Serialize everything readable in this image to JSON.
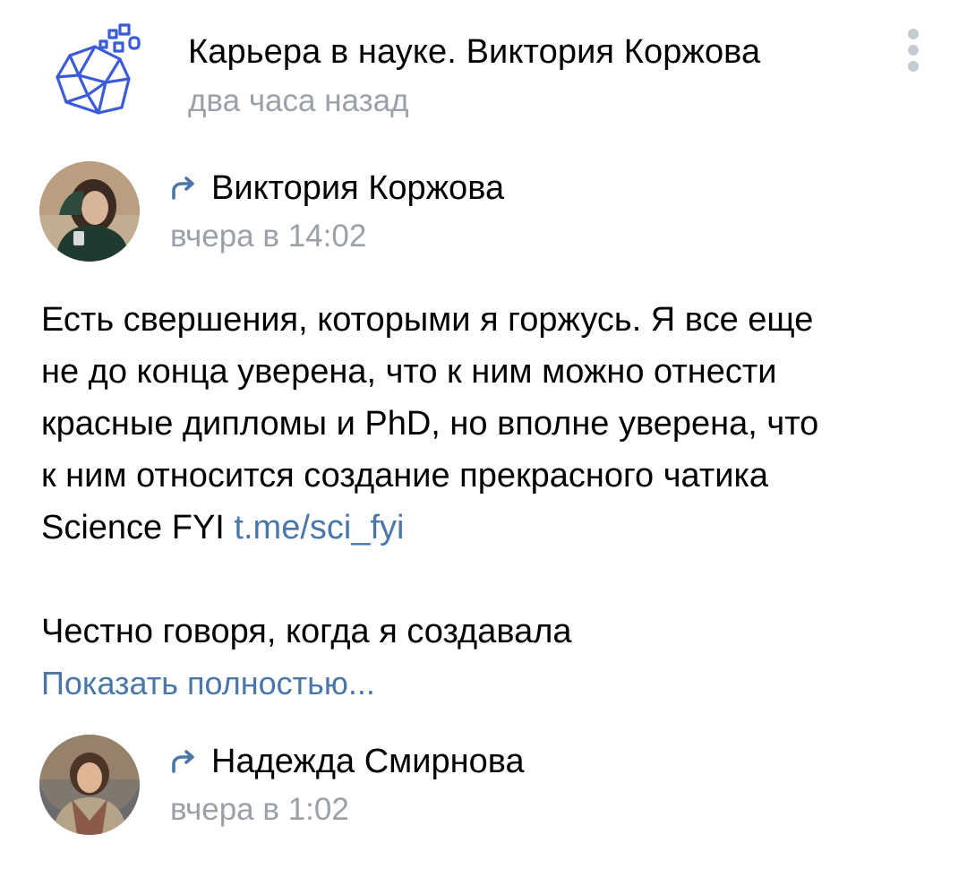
{
  "header": {
    "community_name": "Карьера в науке. Виктория Коржова",
    "time": "два часа назад",
    "logo_icon": "geometric-stone-logo-icon",
    "menu_icon": "vertical-dots-icon"
  },
  "repost_1": {
    "author": "Виктория Коржова",
    "time": "вчера в 14:02",
    "icon": "repost-arrow-icon"
  },
  "post": {
    "text_lines": [
      "Есть свершения, которыми я горжусь. Я все еще",
      "не до конца уверена, что к ним можно отнести",
      "красные дипломы и PhD, но вполне уверена, что",
      "к ним относится создание прекрасного чатика"
    ],
    "last_line_prefix": "Science FYI ",
    "link": "t.me/sci_fyi",
    "paragraph_2": "Честно говоря, когда я создавала",
    "show_more": "Показать полностью..."
  },
  "repost_2": {
    "author": "Надежда Смирнова",
    "time": "вчера в 1:02",
    "icon": "repost-arrow-icon"
  },
  "colors": {
    "accent": "#4a76a8",
    "secondary_text": "#9aa1a9",
    "logo_blue": "#3b5bd9"
  }
}
